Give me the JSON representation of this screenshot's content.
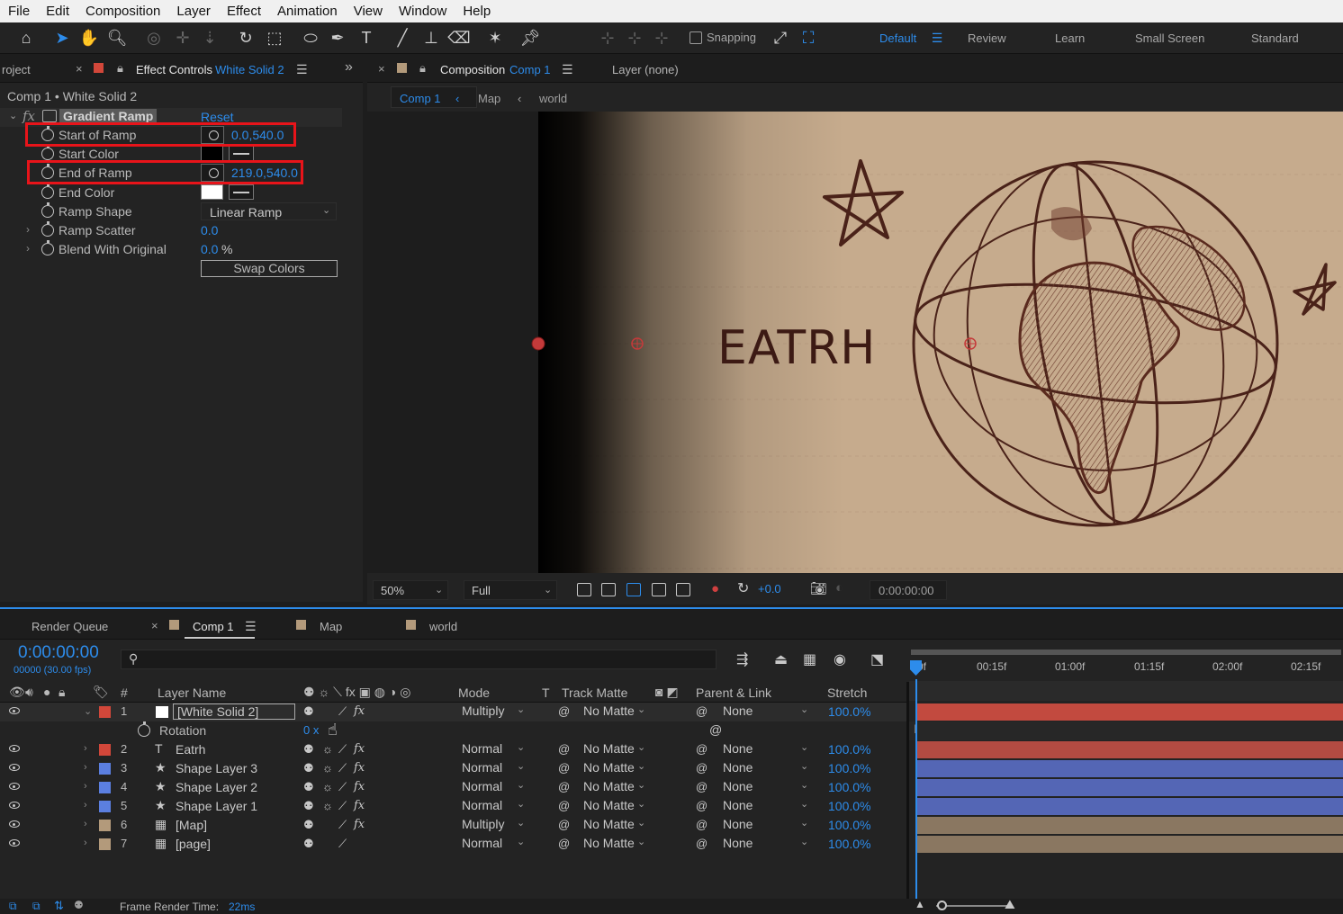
{
  "menu": [
    "File",
    "Edit",
    "Composition",
    "Layer",
    "Effect",
    "Animation",
    "View",
    "Window",
    "Help"
  ],
  "toolbar": {
    "snapping_label": "Snapping",
    "workspaces": [
      "Default",
      "Review",
      "Learn",
      "Small Screen",
      "Standard"
    ]
  },
  "effect_panel": {
    "project_tab": "roject",
    "tab_label": "Effect Controls",
    "tab_target": "White Solid 2",
    "breadcrumb": "Comp 1 • White Solid 2",
    "effect_name": "Gradient Ramp",
    "reset_label": "Reset",
    "props": {
      "start_of_ramp": {
        "label": "Start of Ramp",
        "value": "0.0,540.0"
      },
      "start_color": {
        "label": "Start Color",
        "color": "#000000"
      },
      "end_of_ramp": {
        "label": "End of Ramp",
        "value": "219.0,540.0"
      },
      "end_color": {
        "label": "End Color",
        "color": "#ffffff"
      },
      "ramp_shape": {
        "label": "Ramp Shape",
        "value": "Linear Ramp"
      },
      "ramp_scatter": {
        "label": "Ramp Scatter",
        "value": "0.0"
      },
      "blend_with_original": {
        "label": "Blend With Original",
        "value": "0.0",
        "unit": "%"
      }
    },
    "swap_colors_label": "Swap Colors"
  },
  "comp_panel": {
    "tab_label": "Composition",
    "tab_target": "Comp 1",
    "layer_tab": "Layer (none)",
    "subtabs": [
      "Comp 1",
      "Map",
      "world"
    ],
    "canvas_text": "EATRH",
    "zoom": "50%",
    "resolution": "Full",
    "exposure": "+0.0",
    "timecode": "0:00:00:00"
  },
  "timeline": {
    "tabs": [
      "Render Queue",
      "Comp 1",
      "Map",
      "world"
    ],
    "current_time": "0:00:00:00",
    "frame_info": "00000 (30.00 fps)",
    "columns": {
      "layer_name": "Layer Name",
      "mode": "Mode",
      "t": "T",
      "track_matte": "Track Matte",
      "parent": "Parent & Link",
      "stretch": "Stretch",
      "num": "#"
    },
    "ruler": [
      "0f",
      "00:15f",
      "01:00f",
      "01:15f",
      "02:00f",
      "02:15f"
    ],
    "rotation_label": "Rotation",
    "rotation_value": "0 x",
    "layers": [
      {
        "num": "1",
        "name": "[White Solid 2]",
        "mode": "Multiply",
        "matte": "No Matte",
        "parent": "None",
        "stretch": "100.0%",
        "color": "#d2473a",
        "bar": "#c24a3f",
        "type": "solid"
      },
      {
        "num": "2",
        "name": "Eatrh",
        "mode": "Normal",
        "matte": "No Matte",
        "parent": "None",
        "stretch": "100.0%",
        "color": "#d2473a",
        "bar": "#b34b42",
        "type": "T"
      },
      {
        "num": "3",
        "name": "Shape Layer 3",
        "mode": "Normal",
        "matte": "No Matte",
        "parent": "None",
        "stretch": "100.0%",
        "color": "#5b7fe0",
        "bar": "#5466b5",
        "type": "★"
      },
      {
        "num": "4",
        "name": "Shape Layer 2",
        "mode": "Normal",
        "matte": "No Matte",
        "parent": "None",
        "stretch": "100.0%",
        "color": "#5b7fe0",
        "bar": "#5466b5",
        "type": "★"
      },
      {
        "num": "5",
        "name": "Shape Layer 1",
        "mode": "Normal",
        "matte": "No Matte",
        "parent": "None",
        "stretch": "100.0%",
        "color": "#5b7fe0",
        "bar": "#5466b5",
        "type": "★"
      },
      {
        "num": "6",
        "name": "[Map]",
        "mode": "Multiply",
        "matte": "No Matte",
        "parent": "None",
        "stretch": "100.0%",
        "color": "#b39a7b",
        "bar": "#8a7761",
        "type": "comp"
      },
      {
        "num": "7",
        "name": "[page]",
        "mode": "Normal",
        "matte": "No Matte",
        "parent": "None",
        "stretch": "100.0%",
        "color": "#b39a7b",
        "bar": "#8a7761",
        "type": "comp"
      }
    ],
    "status_label": "Frame Render Time:",
    "status_value": "22ms"
  }
}
